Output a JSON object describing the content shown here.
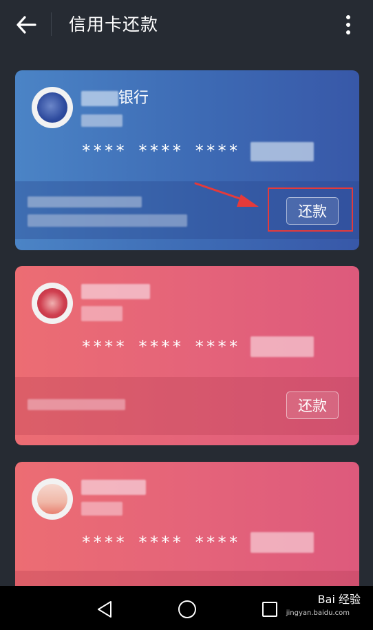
{
  "header": {
    "title": "信用卡还款",
    "back_icon": "arrow-left-icon",
    "menu_icon": "more-vertical-icon"
  },
  "cards": [
    {
      "bank_name_visible": "银行",
      "masked_number": "****  ****  ****",
      "repay_label": "还款",
      "color": "#4272bd"
    },
    {
      "masked_number": "****  ****  ****",
      "repay_label": "还款",
      "color": "#e6667a"
    },
    {
      "masked_number": "****  ****  ****",
      "color": "#e6667a"
    }
  ],
  "annotation": {
    "highlight_color": "#e53a3a"
  },
  "navbar": {
    "back_icon": "triangle-back-icon",
    "home_icon": "circle-home-icon",
    "recents_icon": "square-recents-icon"
  },
  "watermark": {
    "text": "Bai 经验",
    "sub": "jingyan.baidu.com"
  }
}
